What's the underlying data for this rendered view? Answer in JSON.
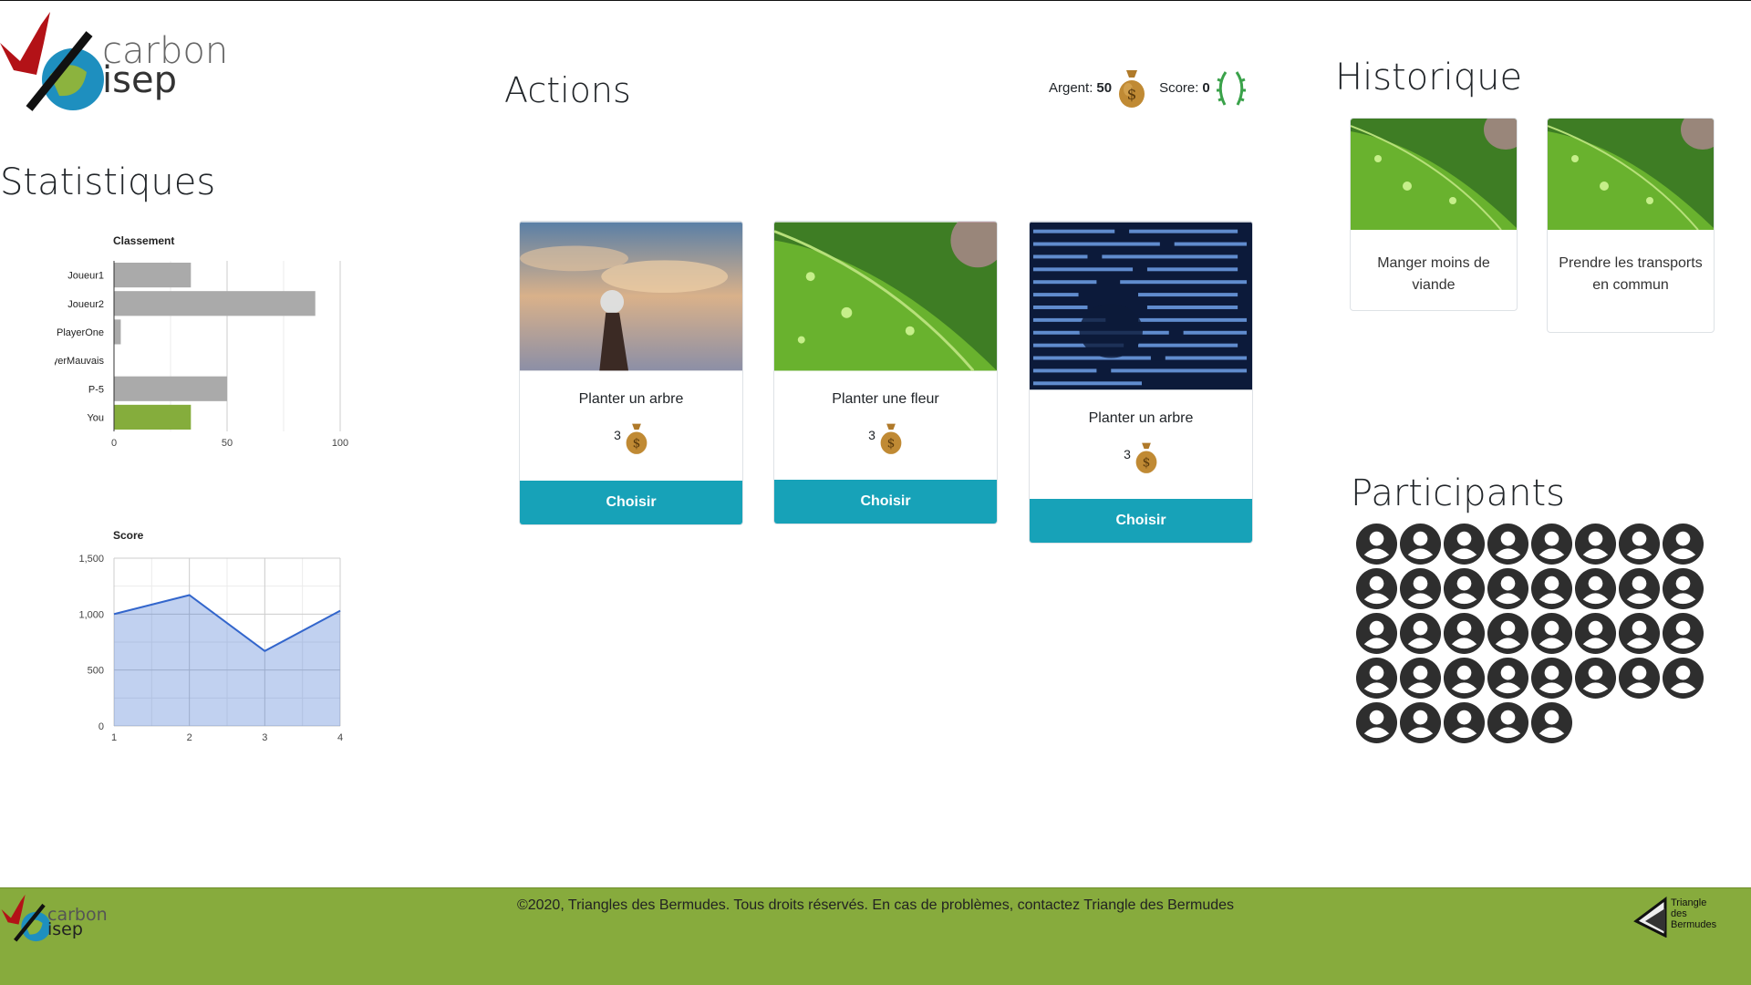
{
  "brand": {
    "line1": "carbon",
    "line2": "isep"
  },
  "sections": {
    "stats": "Statistiques",
    "actions": "Actions",
    "historique": "Historique",
    "participants": "Participants"
  },
  "wallet": {
    "money_label": "Argent:",
    "money": "50",
    "score_label": "Score:",
    "score": "0"
  },
  "actions": [
    {
      "title": "Planter un arbre",
      "price": "3",
      "button": "Choisir",
      "image": "lightbulb-sunset"
    },
    {
      "title": "Planter une fleur",
      "price": "3",
      "button": "Choisir",
      "image": "green-leaf"
    },
    {
      "title": "Planter un arbre",
      "price": "3",
      "button": "Choisir",
      "image": "code-screen"
    }
  ],
  "history": [
    {
      "label": "Manger moins de viande",
      "image": "green-leaf"
    },
    {
      "label": "Prendre les transports en commun",
      "image": "green-leaf"
    }
  ],
  "participants_count": 37,
  "footer": {
    "text": "©2020, Triangles des Bermudes. Tous droits réservés. En cas de problèmes, contactez Triangle des Bermudes",
    "partner_logo": [
      "Triangle",
      "des",
      "Bermudes"
    ]
  },
  "colors": {
    "accent": "#17a2b8",
    "footer": "#87ab3d",
    "bar_default": "#aaaaaa",
    "bar_you": "#85ad3c",
    "area": "#3366cc"
  },
  "chart_data": [
    {
      "type": "bar",
      "title": "Classement",
      "categories": [
        "Joueur1",
        "Joueur2",
        "PlayerOne",
        "PlayerMauvais",
        "P-5",
        "You"
      ],
      "values": [
        34,
        89,
        3,
        0,
        50,
        34
      ],
      "xlim": [
        0,
        100
      ],
      "xticks": [
        "0",
        "50",
        "100"
      ]
    },
    {
      "type": "area",
      "title": "Score",
      "x": [
        1,
        2,
        3,
        4
      ],
      "values": [
        1000,
        1170,
        670,
        1030
      ],
      "ylim": [
        0,
        1500
      ],
      "yticks": [
        "0",
        "500",
        "1,000",
        "1,500"
      ],
      "xticks": [
        "1",
        "2",
        "3",
        "4"
      ]
    }
  ]
}
